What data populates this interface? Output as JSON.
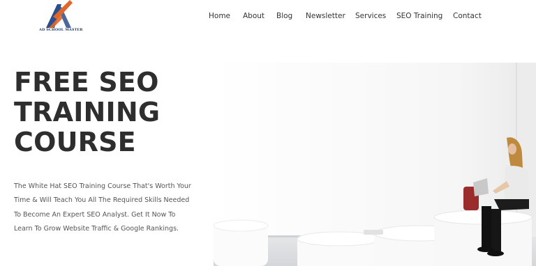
{
  "logo": {
    "text": "AD SCHOOL MASTER",
    "colors": {
      "blue": "#2b4f8c",
      "orange": "#e0672a"
    }
  },
  "nav": {
    "items": [
      {
        "label": "Home"
      },
      {
        "label": "About"
      },
      {
        "label": "Blog"
      },
      {
        "label": "Newsletter"
      },
      {
        "label": "Services"
      },
      {
        "label": "SEO Training"
      },
      {
        "label": "Contact"
      }
    ]
  },
  "hero": {
    "title_lines": [
      "FREE SEO",
      "TRAINING",
      "COURSE"
    ],
    "description": "The White Hat SEO Training Course That's Worth Your Time & Will Teach You All The Required Skills Needed To Become An Expert SEO Analyst. Get It Now To Learn To Grow Website Traffic & Google Rankings.",
    "photo_icon": "woman-with-laptop-photo"
  }
}
